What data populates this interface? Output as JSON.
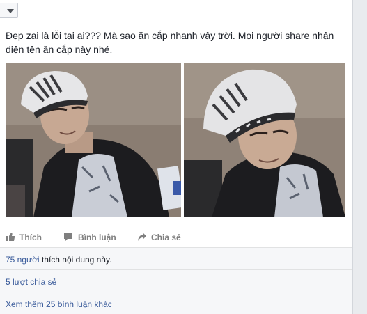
{
  "post": {
    "text": "Đẹp zai là lỗi tại ai??? Mà sao ăn cắp nhanh vậy trời. Mọi người share nhận diện tên ăn cắp này nhé."
  },
  "actions": {
    "like_label": "Thích",
    "comment_label": "Bình luận",
    "share_label": "Chia sẻ"
  },
  "summary": {
    "likes_link": "75 người",
    "likes_suffix": " thích nội dung này.",
    "shares_link": "5 lượt chia sẻ",
    "comments_link": "Xem thêm 25 bình luận khác"
  },
  "icons": {
    "post_menu": "chevron-down-icon",
    "like": "thumbs-up-icon",
    "comment": "speech-bubble-icon",
    "share": "share-arrow-icon"
  },
  "colors": {
    "link": "#365899",
    "action_text": "#7f7f7f",
    "row_background": "#f6f7f9",
    "page_background": "#e9ebee"
  }
}
